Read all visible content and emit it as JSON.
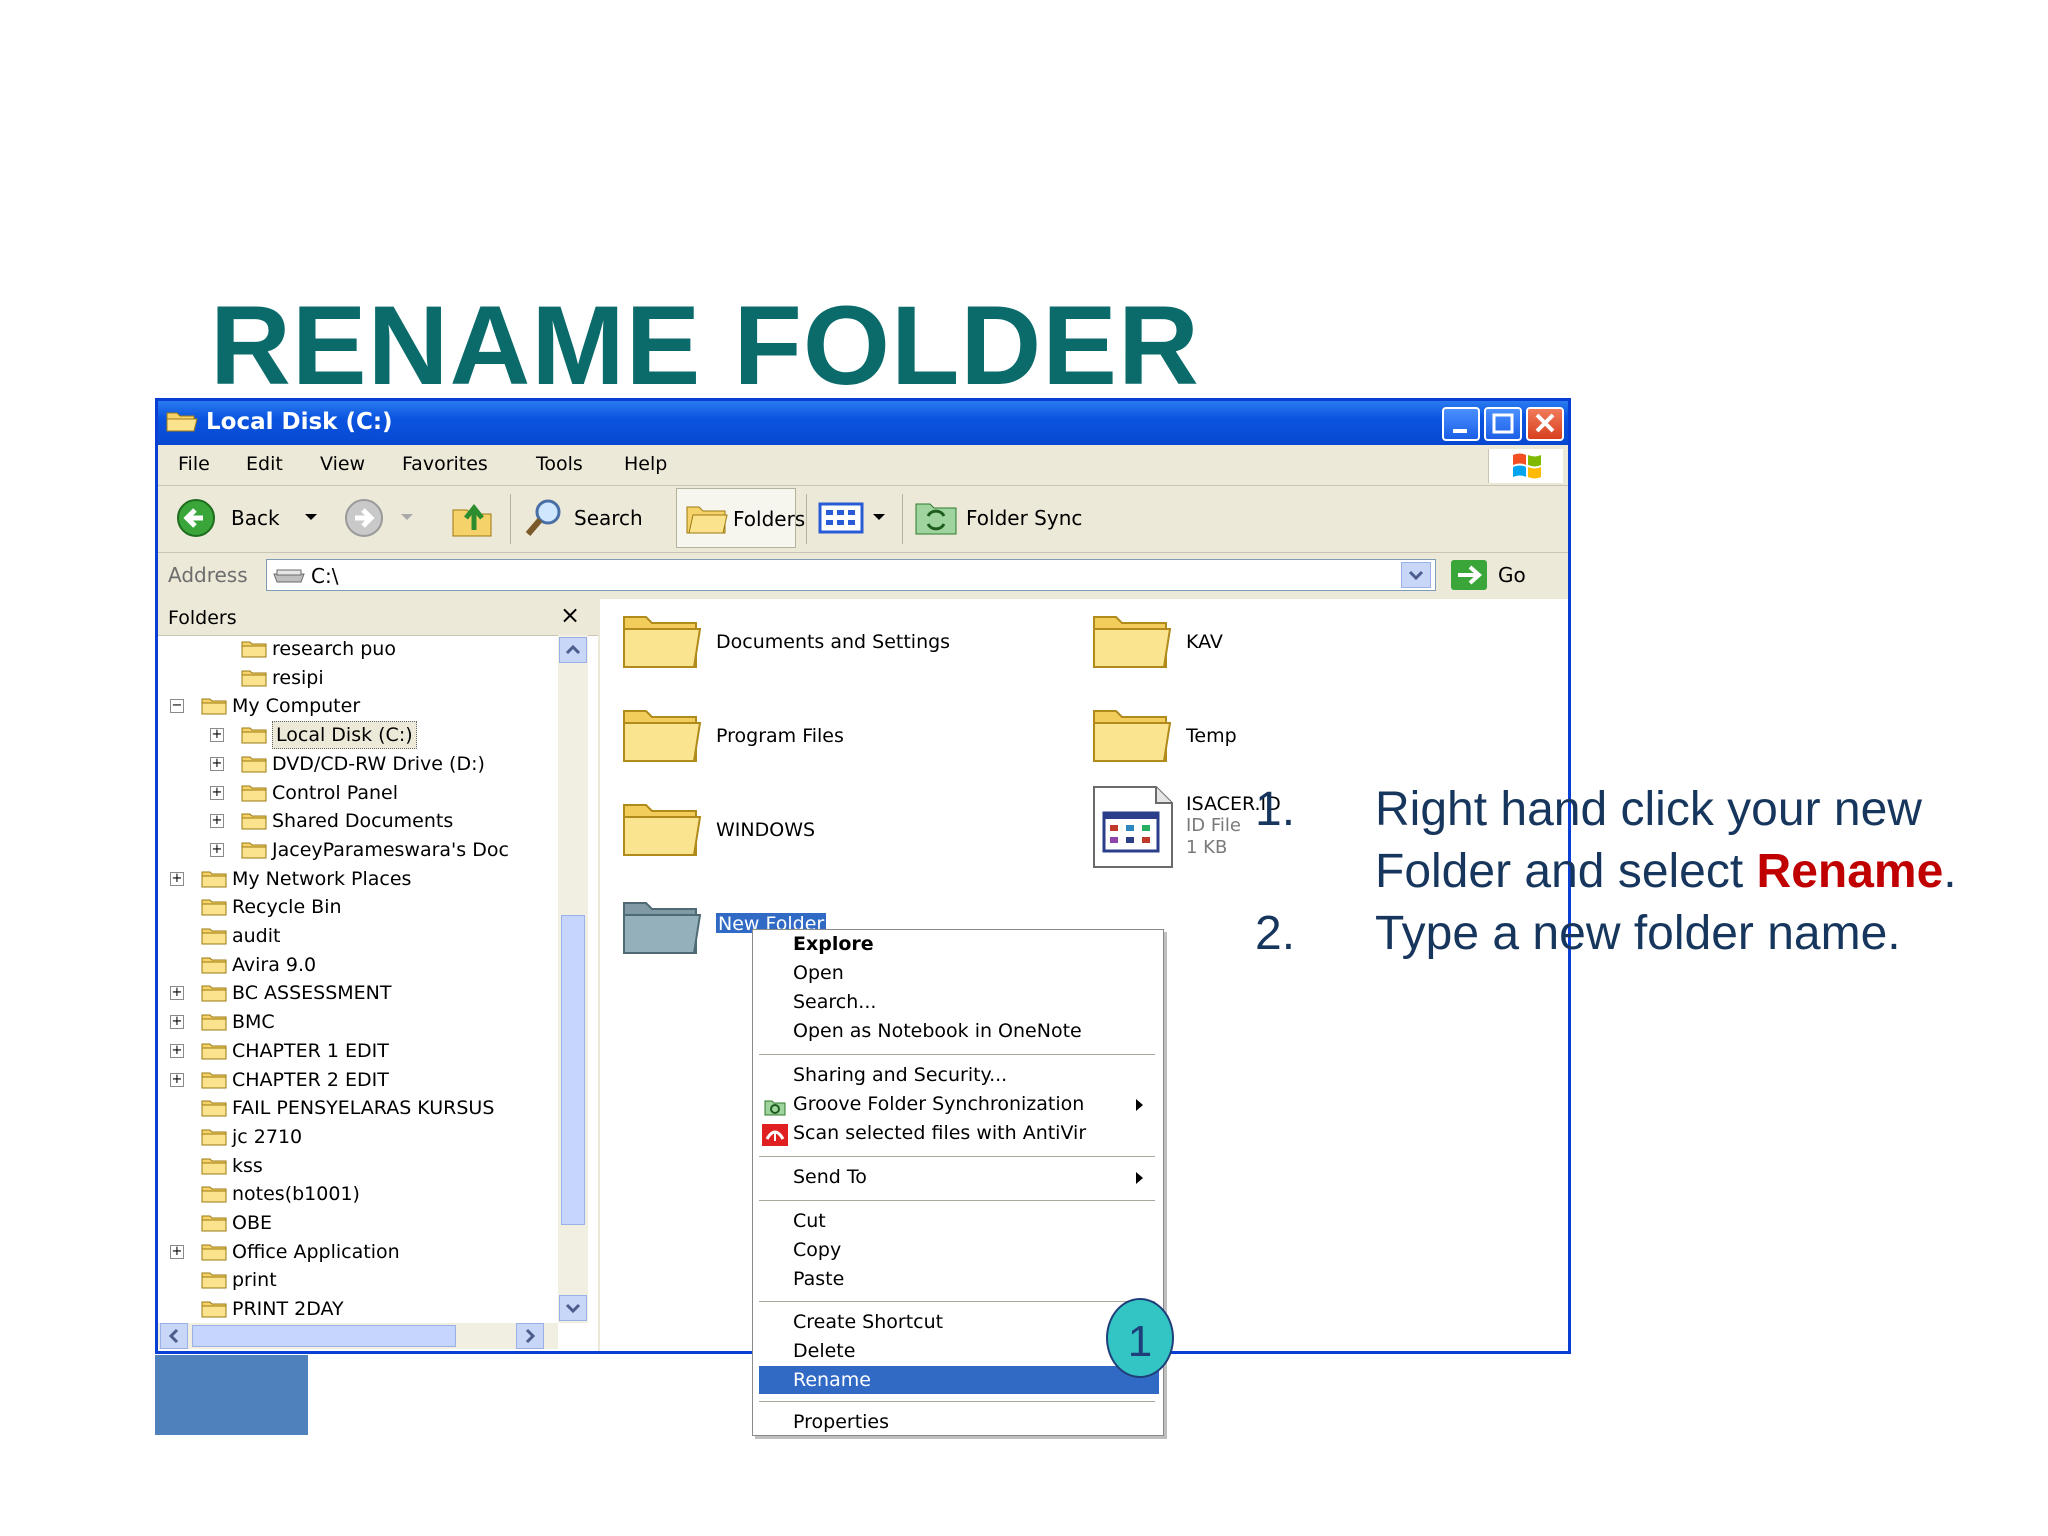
{
  "slide": {
    "title": "RENAME FOLDER",
    "steps": [
      {
        "num": "1.",
        "line1": "Right hand click your new",
        "line2_a": "Folder and select ",
        "line2_b": "Rename",
        "line2_c": "."
      },
      {
        "num": "2.",
        "line1": "Type a new folder name."
      }
    ],
    "callout_number": "1"
  },
  "window": {
    "title": "Local Disk (C:)",
    "menu": [
      "File",
      "Edit",
      "View",
      "Favorites",
      "Tools",
      "Help"
    ],
    "toolbar": {
      "back": "Back",
      "search": "Search",
      "folders": "Folders",
      "folder_sync": "Folder Sync"
    },
    "address": {
      "label": "Address",
      "value": "C:\\",
      "go": "Go"
    },
    "folders_pane": {
      "header": "Folders",
      "close": "×",
      "items": [
        {
          "label": "research puo"
        },
        {
          "label": "resipi"
        },
        {
          "label": "My Computer",
          "expander": "−"
        },
        {
          "label": "Local Disk (C:)",
          "expander": "+"
        },
        {
          "label": "DVD/CD-RW Drive (D:)",
          "expander": "+"
        },
        {
          "label": "Control Panel",
          "expander": "+"
        },
        {
          "label": "Shared Documents",
          "expander": "+"
        },
        {
          "label": "JaceyParameswara's Doc",
          "expander": "+"
        },
        {
          "label": "My Network Places",
          "expander": "+"
        },
        {
          "label": "Recycle Bin"
        },
        {
          "label": "audit"
        },
        {
          "label": "Avira 9.0"
        },
        {
          "label": "BC ASSESSMENT",
          "expander": "+"
        },
        {
          "label": "BMC",
          "expander": "+"
        },
        {
          "label": "CHAPTER 1 EDIT",
          "expander": "+"
        },
        {
          "label": "CHAPTER 2 EDIT",
          "expander": "+"
        },
        {
          "label": "FAIL PENSYELARAS KURSUS"
        },
        {
          "label": "jc 2710"
        },
        {
          "label": "kss"
        },
        {
          "label": "notes(b1001)"
        },
        {
          "label": "OBE"
        },
        {
          "label": "Office Application",
          "expander": "+"
        },
        {
          "label": "print"
        },
        {
          "label": "PRINT 2DAY"
        }
      ]
    },
    "content": {
      "items": [
        {
          "label": "Documents and Settings"
        },
        {
          "label": "KAV"
        },
        {
          "label": "Program Files"
        },
        {
          "label": "Temp"
        },
        {
          "label": "WINDOWS"
        },
        {
          "label": "ISACER.ID",
          "type": "ID File",
          "size": "1 KB"
        },
        {
          "label": "New Folder"
        }
      ]
    },
    "context_menu": {
      "items": [
        "Explore",
        "Open",
        "Search...",
        "Open as Notebook in OneNote",
        "Sharing and Security...",
        "Groove Folder Synchronization",
        "Scan selected files with AntiVir",
        "Send To",
        "Cut",
        "Copy",
        "Paste",
        "Create Shortcut",
        "Delete",
        "Rename",
        "Properties"
      ],
      "highlighted": "Rename"
    }
  },
  "colors": {
    "title": "#0b6b6b",
    "steps": "#17365d",
    "accent": "#c00000",
    "selection": "#316ac5",
    "xp_blue": "#0a54e0"
  }
}
